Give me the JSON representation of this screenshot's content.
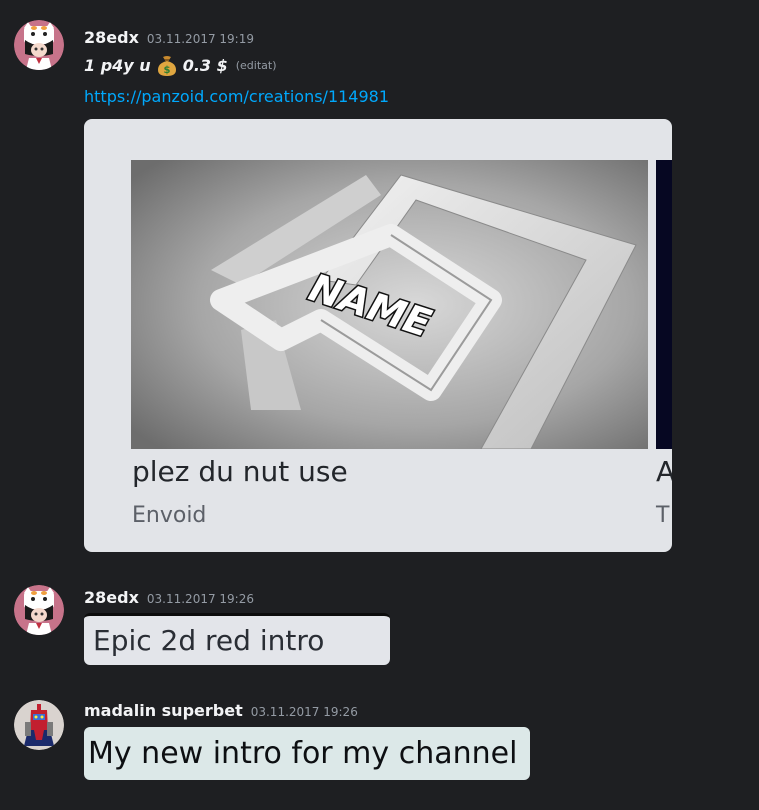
{
  "messages": [
    {
      "username": "28edx",
      "timestamp": "03.11.2017 19:19",
      "content_part1": "1 p4y u",
      "content_part2": "0.3 $",
      "emoji_icon": "money-bag-icon",
      "edited_label": "(editat)",
      "link": "https://panzoid.com/creations/114981",
      "embed": {
        "thumbnail_text": "NAME",
        "title": "plez du nut use",
        "subtitle": "Envoid",
        "next_title_partial": "A",
        "next_subtitle_partial": "T"
      }
    },
    {
      "username": "28edx",
      "timestamp": "03.11.2017 19:26",
      "image_text": "Epic 2d red intro"
    },
    {
      "username": "madalin superbet",
      "timestamp": "03.11.2017 19:26",
      "image_text": "My new intro for my channel"
    }
  ],
  "colors": {
    "background": "#1e1f22",
    "username": "#f2f3f5",
    "timestamp": "#949ba4",
    "link": "#00a8fc",
    "embed_bg": "#e2e4e8"
  }
}
